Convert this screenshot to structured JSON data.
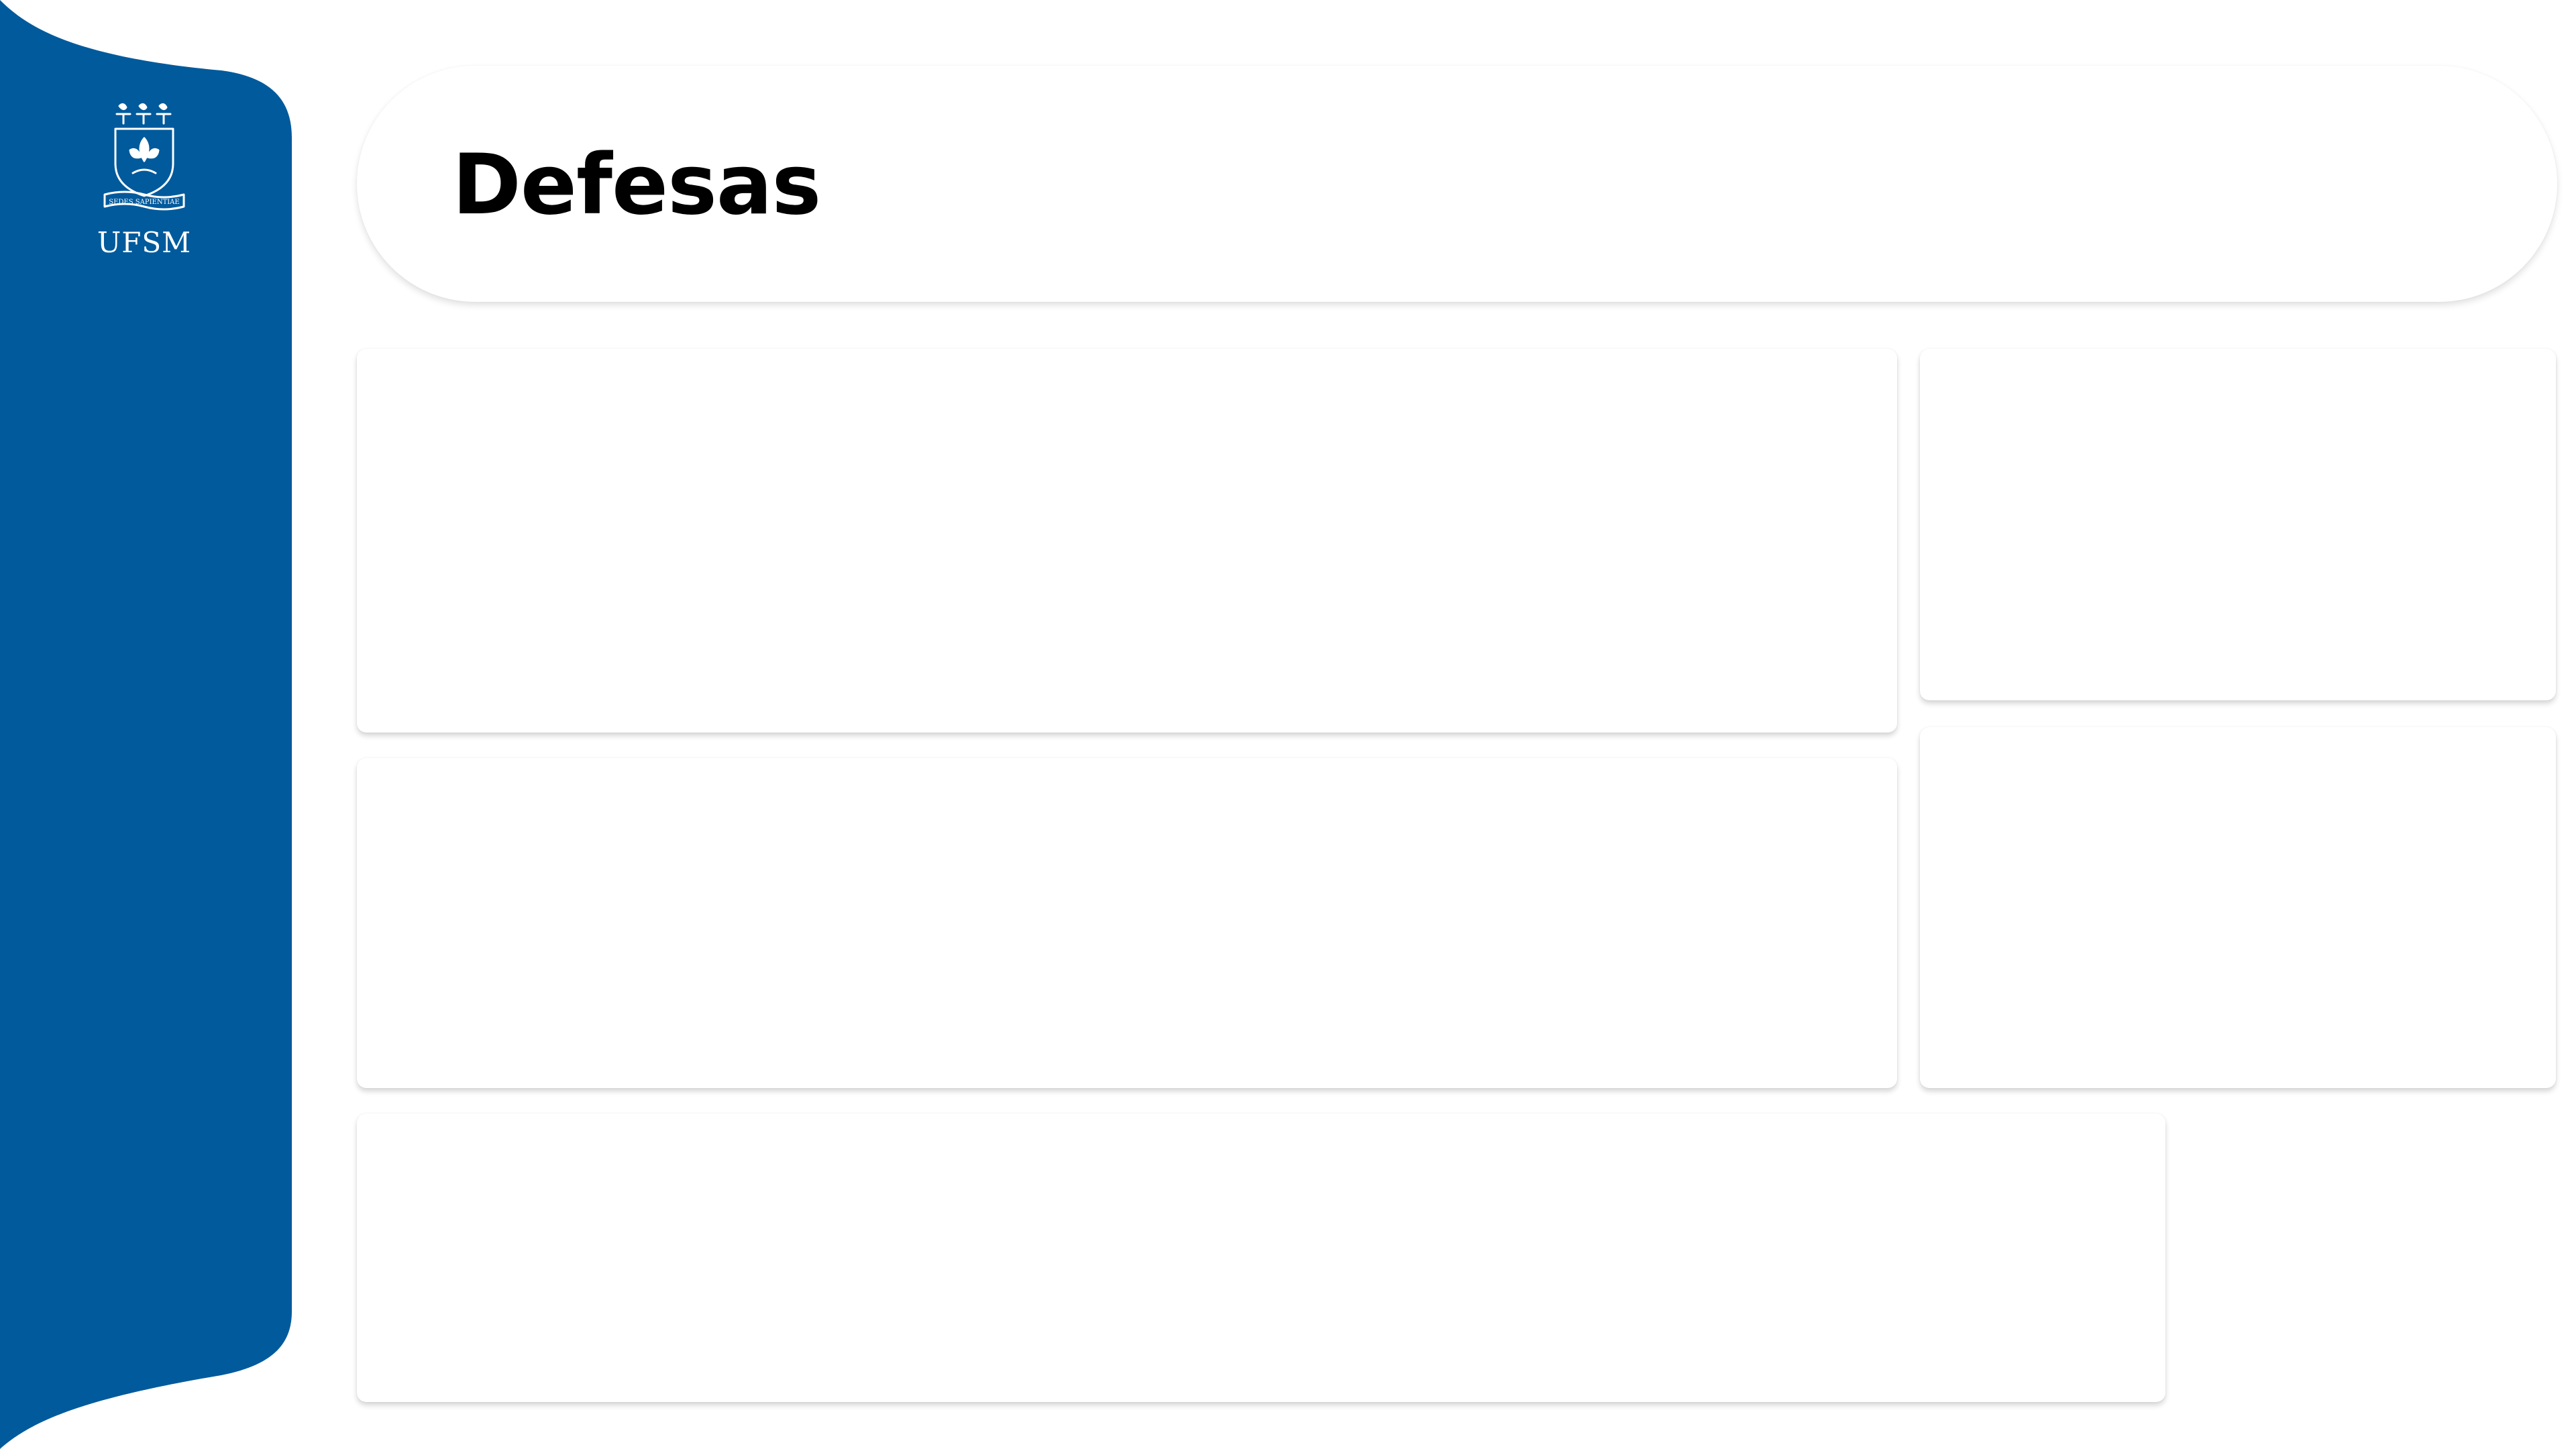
{
  "header": {
    "title": "Defesas"
  },
  "sidebar": {
    "brand": "UFSM",
    "logo_icon": "ufsm-crest-icon"
  },
  "colors": {
    "sidebar": "#005A9C",
    "background": "#FFFFFF",
    "title": "#000000"
  },
  "cards": [
    {
      "id": "card-1",
      "content": ""
    },
    {
      "id": "card-2",
      "content": ""
    },
    {
      "id": "card-3",
      "content": ""
    },
    {
      "id": "card-4",
      "content": ""
    },
    {
      "id": "card-5",
      "content": ""
    }
  ]
}
